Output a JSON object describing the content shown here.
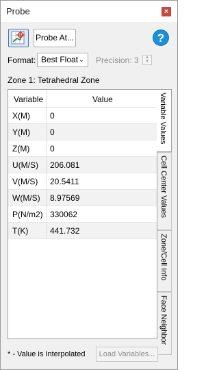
{
  "window": {
    "title": "Probe",
    "close_glyph": "×"
  },
  "toolbar": {
    "probe_icon_name": "probe-crosshair-icon",
    "probe_at_label": "Probe At...",
    "help_glyph": "?"
  },
  "format": {
    "label": "Format:",
    "selected": "Best Float",
    "precision_label": "Precision:",
    "precision_value": "3"
  },
  "zone": {
    "label": "Zone 1: Tetrahedral Zone"
  },
  "table": {
    "headers": {
      "variable": "Variable",
      "value": "Value"
    },
    "rows": [
      {
        "variable": "X(M)",
        "value": "0"
      },
      {
        "variable": "Y(M)",
        "value": "0"
      },
      {
        "variable": "Z(M)",
        "value": "0"
      },
      {
        "variable": "U(M/S)",
        "value": "206.081"
      },
      {
        "variable": "V(M/S)",
        "value": "20.5411"
      },
      {
        "variable": "W(M/S)",
        "value": "8.97569"
      },
      {
        "variable": "P(N/m2)",
        "value": "330062"
      },
      {
        "variable": "T(K)",
        "value": "441.732"
      }
    ]
  },
  "side_tabs": [
    {
      "label": "Variable Values"
    },
    {
      "label": "Cell Center Values"
    },
    {
      "label": "Zone/Cell Info"
    },
    {
      "label": "Face Neighbor"
    }
  ],
  "footer": {
    "note": "* - Value is Interpolated",
    "load_button": "Load Variables..."
  },
  "colors": {
    "close_button": "#c9463d",
    "help_button": "#1c8fd6"
  }
}
